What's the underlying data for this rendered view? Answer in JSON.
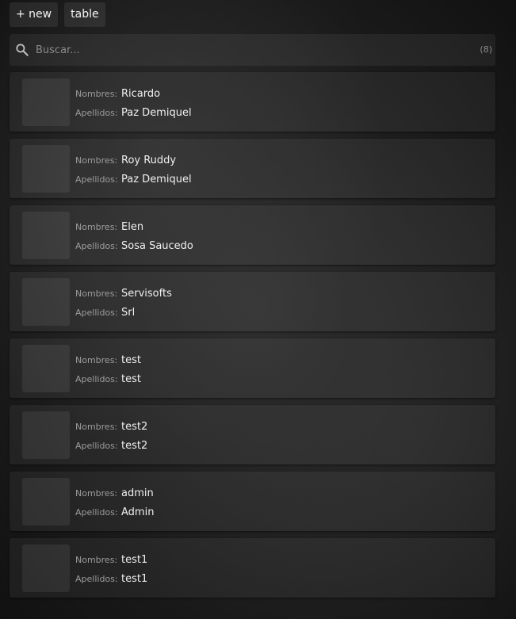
{
  "toolbar": {
    "new_label": "+ new",
    "table_label": "table"
  },
  "search": {
    "placeholder": "Buscar...",
    "value": "",
    "count": "(8)"
  },
  "labels": {
    "nombres": "Nombres:",
    "apellidos": "Apellidos:"
  },
  "records": [
    {
      "nombres": "Ricardo",
      "apellidos": "Paz Demiquel"
    },
    {
      "nombres": "Roy Ruddy",
      "apellidos": "Paz Demiquel"
    },
    {
      "nombres": "Elen",
      "apellidos": "Sosa Saucedo"
    },
    {
      "nombres": "Servisofts",
      "apellidos": "Srl"
    },
    {
      "nombres": "test",
      "apellidos": "test"
    },
    {
      "nombres": "test2",
      "apellidos": "test2"
    },
    {
      "nombres": "admin",
      "apellidos": "Admin"
    },
    {
      "nombres": "test1",
      "apellidos": "test1"
    }
  ]
}
